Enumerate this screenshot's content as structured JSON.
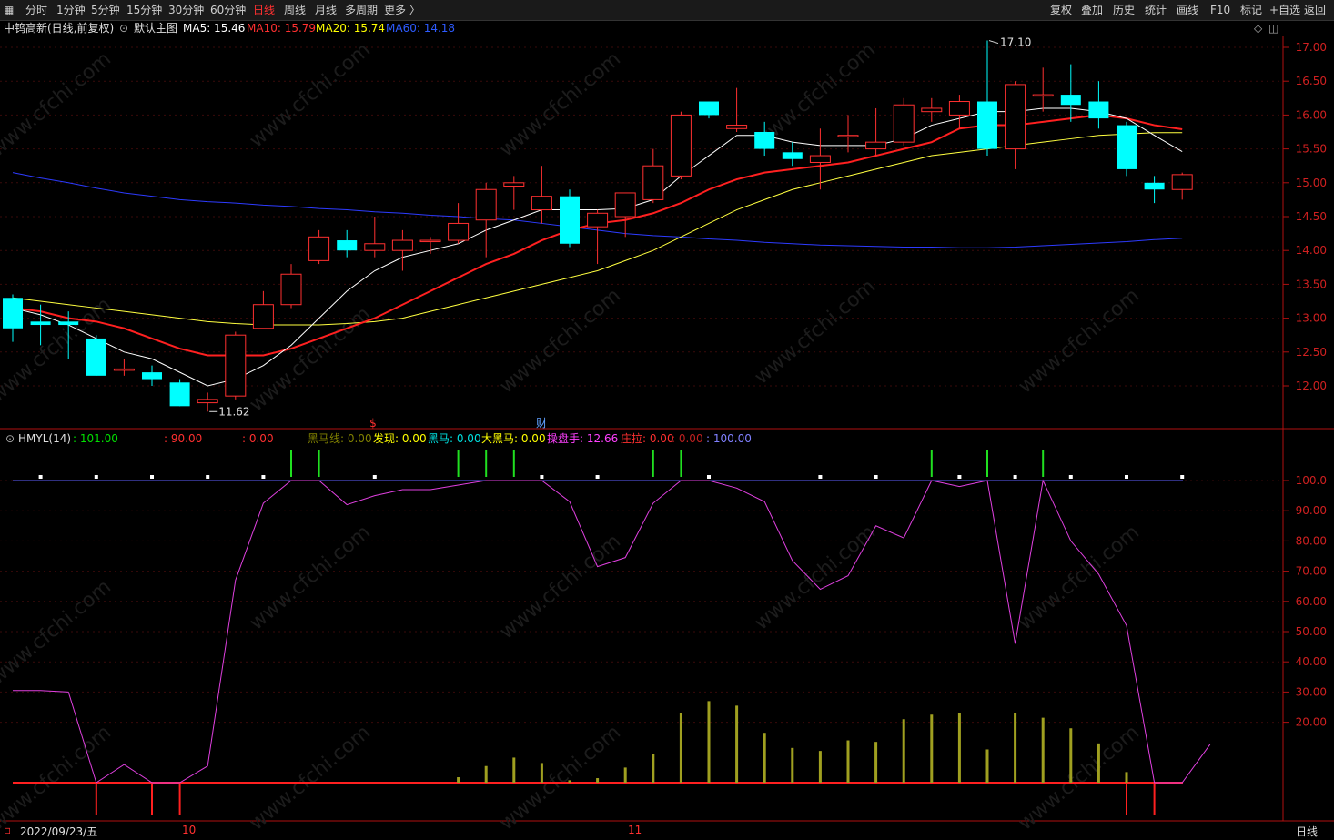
{
  "toolbar": {
    "left_icon": "grid-icon",
    "periods": [
      {
        "label": "分时",
        "active": false
      },
      {
        "label": "1分钟",
        "active": false
      },
      {
        "label": "5分钟",
        "active": false
      },
      {
        "label": "15分钟",
        "active": false
      },
      {
        "label": "30分钟",
        "active": false
      },
      {
        "label": "60分钟",
        "active": false
      },
      {
        "label": "日线",
        "active": true
      },
      {
        "label": "周线",
        "active": false
      },
      {
        "label": "月线",
        "active": false
      },
      {
        "label": "多周期",
        "active": false
      },
      {
        "label": "更多 〉",
        "active": false
      }
    ],
    "right_items": [
      "复权",
      "叠加",
      "历史",
      "统计",
      "画线",
      "F10",
      "标记",
      "+自选",
      "返回"
    ]
  },
  "main_chart": {
    "stock_title": "中钨高新(日线,前复权)",
    "template_label": "默认主图",
    "ma_labels": [
      {
        "text": "MA5: 15.46",
        "color": "#ffffff"
      },
      {
        "text": "MA10: 15.79",
        "color": "#ff3030"
      },
      {
        "text": "MA20: 15.74",
        "color": "#ffff00"
      },
      {
        "text": "MA60: 14.18",
        "color": "#2d5bff"
      }
    ],
    "high_label": "17.10",
    "low_label": "11.62",
    "marker_s": "$",
    "marker_cai": "财",
    "y_ticks": [
      "17.00",
      "16.50",
      "16.00",
      "15.50",
      "15.00",
      "14.50",
      "14.00",
      "13.50",
      "13.00",
      "12.50",
      "12.00"
    ],
    "watermark": "www.cfchi.com"
  },
  "indicator": {
    "name": "HMYL(14)",
    "values": [
      {
        "text": ": 101.00",
        "color": "#00e000"
      },
      {
        "text": ": 90.00",
        "color": "#ff3030"
      },
      {
        "text": ": 0.00",
        "color": "#ff3030"
      },
      {
        "text": "黑马线: 0.00",
        "color": "#808000"
      },
      {
        "text": "发现: 0.00",
        "color": "#ffff00"
      },
      {
        "text": "黑马: 0.00",
        "color": "#00e0e0"
      },
      {
        "text": "大黑马: 0.00",
        "color": "#ffff00"
      },
      {
        "text": "操盘手: 12.66",
        "color": "#ff40ff"
      },
      {
        "text": "庄拉: 0.00",
        "color": "#ff3030"
      },
      {
        "text": ": 0.00",
        "color": "#c02020"
      },
      {
        "text": ": 100.00",
        "color": "#8080ff"
      }
    ],
    "y_ticks": [
      "100.0",
      "90.00",
      "80.00",
      "70.00",
      "60.00",
      "50.00",
      "40.00",
      "30.00",
      "20.00"
    ]
  },
  "bottom": {
    "start_date": "2022/09/23/五",
    "month_10": "10",
    "month_11": "11",
    "period_label": "日线"
  },
  "chart_data": {
    "type": "candlestick",
    "candles": [
      {
        "o": 13.3,
        "h": 13.35,
        "l": 12.65,
        "c": 12.85
      },
      {
        "o": 12.95,
        "h": 13.2,
        "l": 12.6,
        "c": 12.9
      },
      {
        "o": 12.95,
        "h": 13.1,
        "l": 12.4,
        "c": 12.9
      },
      {
        "o": 12.7,
        "h": 12.75,
        "l": 12.15,
        "c": 12.15
      },
      {
        "o": 12.25,
        "h": 12.4,
        "l": 12.15,
        "c": 12.25
      },
      {
        "o": 12.2,
        "h": 12.3,
        "l": 12.0,
        "c": 12.1
      },
      {
        "o": 12.05,
        "h": 12.1,
        "l": 11.7,
        "c": 11.7
      },
      {
        "o": 11.75,
        "h": 11.9,
        "l": 11.62,
        "c": 11.8
      },
      {
        "o": 11.85,
        "h": 12.8,
        "l": 11.8,
        "c": 12.75
      },
      {
        "o": 12.85,
        "h": 13.4,
        "l": 12.85,
        "c": 13.2
      },
      {
        "o": 13.2,
        "h": 13.8,
        "l": 13.15,
        "c": 13.65
      },
      {
        "o": 13.85,
        "h": 14.3,
        "l": 13.8,
        "c": 14.2
      },
      {
        "o": 14.15,
        "h": 14.3,
        "l": 13.9,
        "c": 14.0
      },
      {
        "o": 14.0,
        "h": 14.5,
        "l": 13.9,
        "c": 14.1
      },
      {
        "o": 14.0,
        "h": 14.3,
        "l": 13.7,
        "c": 14.15
      },
      {
        "o": 14.15,
        "h": 14.2,
        "l": 13.95,
        "c": 14.15
      },
      {
        "o": 14.15,
        "h": 14.7,
        "l": 14.1,
        "c": 14.4
      },
      {
        "o": 14.45,
        "h": 15.0,
        "l": 13.9,
        "c": 14.9
      },
      {
        "o": 14.95,
        "h": 15.1,
        "l": 14.6,
        "c": 15.0
      },
      {
        "o": 14.6,
        "h": 15.25,
        "l": 14.4,
        "c": 14.8
      },
      {
        "o": 14.8,
        "h": 14.9,
        "l": 14.05,
        "c": 14.1
      },
      {
        "o": 14.35,
        "h": 14.6,
        "l": 13.8,
        "c": 14.55
      },
      {
        "o": 14.5,
        "h": 14.85,
        "l": 14.2,
        "c": 14.85
      },
      {
        "o": 14.75,
        "h": 15.5,
        "l": 14.7,
        "c": 15.25
      },
      {
        "o": 15.1,
        "h": 16.05,
        "l": 15.05,
        "c": 16.0
      },
      {
        "o": 16.2,
        "h": 16.2,
        "l": 15.95,
        "c": 16.0
      },
      {
        "o": 15.8,
        "h": 16.4,
        "l": 15.75,
        "c": 15.85
      },
      {
        "o": 15.75,
        "h": 15.9,
        "l": 15.4,
        "c": 15.5
      },
      {
        "o": 15.45,
        "h": 15.6,
        "l": 15.25,
        "c": 15.35
      },
      {
        "o": 15.3,
        "h": 15.8,
        "l": 14.9,
        "c": 15.4
      },
      {
        "o": 15.7,
        "h": 16.0,
        "l": 15.45,
        "c": 15.7
      },
      {
        "o": 15.5,
        "h": 16.1,
        "l": 15.4,
        "c": 15.6
      },
      {
        "o": 15.6,
        "h": 16.25,
        "l": 15.55,
        "c": 16.15
      },
      {
        "o": 16.05,
        "h": 16.25,
        "l": 15.9,
        "c": 16.1
      },
      {
        "o": 16.0,
        "h": 16.3,
        "l": 15.8,
        "c": 16.2
      },
      {
        "o": 16.2,
        "h": 17.1,
        "l": 15.4,
        "c": 15.5
      },
      {
        "o": 15.5,
        "h": 16.5,
        "l": 15.2,
        "c": 16.45
      },
      {
        "o": 16.3,
        "h": 16.7,
        "l": 16.05,
        "c": 16.3
      },
      {
        "o": 16.3,
        "h": 16.75,
        "l": 15.9,
        "c": 16.15
      },
      {
        "o": 16.2,
        "h": 16.5,
        "l": 15.8,
        "c": 15.95
      },
      {
        "o": 15.85,
        "h": 15.9,
        "l": 15.1,
        "c": 15.2
      },
      {
        "o": 15.0,
        "h": 15.1,
        "l": 14.7,
        "c": 14.9
      },
      {
        "o": 14.9,
        "h": 15.15,
        "l": 14.75,
        "c": 15.12
      }
    ],
    "ma5": [
      13.15,
      13.05,
      12.9,
      12.7,
      12.5,
      12.4,
      12.2,
      12.0,
      12.1,
      12.3,
      12.6,
      13.0,
      13.4,
      13.7,
      13.9,
      14.0,
      14.1,
      14.3,
      14.45,
      14.6,
      14.6,
      14.6,
      14.62,
      14.75,
      15.1,
      15.4,
      15.7,
      15.7,
      15.6,
      15.55,
      15.55,
      15.55,
      15.65,
      15.85,
      15.95,
      16.05,
      16.05,
      16.1,
      16.1,
      16.05,
      15.95,
      15.7,
      15.46
    ],
    "ma10": [
      13.15,
      13.1,
      13.0,
      12.95,
      12.85,
      12.7,
      12.55,
      12.45,
      12.45,
      12.45,
      12.55,
      12.7,
      12.85,
      13.0,
      13.2,
      13.4,
      13.6,
      13.8,
      13.95,
      14.15,
      14.3,
      14.4,
      14.45,
      14.55,
      14.7,
      14.9,
      15.05,
      15.15,
      15.2,
      15.25,
      15.3,
      15.4,
      15.5,
      15.6,
      15.8,
      15.85,
      15.85,
      15.9,
      15.95,
      16.0,
      15.95,
      15.85,
      15.79
    ],
    "ma20": [
      13.3,
      13.25,
      13.2,
      13.15,
      13.1,
      13.05,
      13.0,
      12.95,
      12.92,
      12.9,
      12.9,
      12.9,
      12.92,
      12.95,
      13.0,
      13.1,
      13.2,
      13.3,
      13.4,
      13.5,
      13.6,
      13.7,
      13.85,
      14.0,
      14.2,
      14.4,
      14.6,
      14.75,
      14.9,
      15.0,
      15.1,
      15.2,
      15.3,
      15.4,
      15.45,
      15.5,
      15.55,
      15.6,
      15.65,
      15.7,
      15.72,
      15.74,
      15.74
    ],
    "ma60": [
      15.15,
      15.07,
      15.0,
      14.92,
      14.85,
      14.8,
      14.75,
      14.72,
      14.7,
      14.67,
      14.65,
      14.62,
      14.6,
      14.57,
      14.55,
      14.52,
      14.5,
      14.47,
      14.45,
      14.4,
      14.35,
      14.3,
      14.25,
      14.22,
      14.2,
      14.17,
      14.15,
      14.12,
      14.1,
      14.08,
      14.07,
      14.06,
      14.05,
      14.05,
      14.04,
      14.04,
      14.05,
      14.07,
      14.09,
      14.11,
      14.13,
      14.16,
      14.18
    ],
    "ind_line": [
      30.5,
      30.5,
      30.0,
      0.0,
      6.0,
      0.0,
      0.0,
      5.5,
      67.0,
      92.5,
      100.0,
      100.0,
      92.0,
      95.0,
      97.0,
      97.0,
      98.5,
      100.0,
      100.0,
      100.0,
      93.0,
      71.5,
      74.5,
      92.5,
      100.0,
      100.0,
      97.5,
      93.0,
      73.5,
      64.0,
      68.5,
      85.0,
      81.0,
      100.0,
      98.0,
      100.0,
      46.0,
      100.0,
      80.0,
      69.0,
      52.0,
      0.0,
      0.0,
      12.66
    ],
    "ind_bars": [
      0,
      0,
      0,
      0,
      0,
      0,
      0,
      0,
      0,
      0,
      0,
      0,
      0,
      0,
      0,
      0,
      1.8,
      5.5,
      8.3,
      6.5,
      0.8,
      1.5,
      5.0,
      9.5,
      23.0,
      27.0,
      25.5,
      16.5,
      11.5,
      10.5,
      14.0,
      13.5,
      21.0,
      22.5,
      23.0,
      11.0,
      23.0,
      21.5,
      18.0,
      13.0,
      3.5,
      0,
      0
    ],
    "ind_neg": [
      0,
      0,
      0,
      1,
      0,
      1,
      1,
      0,
      0,
      0,
      0,
      0,
      0,
      0,
      0,
      0,
      0,
      0,
      0,
      0,
      0,
      0,
      0,
      0,
      0,
      0,
      0,
      0,
      0,
      0,
      0,
      0,
      0,
      0,
      0,
      0,
      0,
      0,
      0,
      0,
      1,
      1,
      0
    ],
    "ind_green_top": [
      0,
      0,
      0,
      0,
      0,
      0,
      0,
      0,
      0,
      0,
      1,
      1,
      0,
      0,
      0,
      0,
      1,
      1,
      1,
      0,
      0,
      0,
      0,
      1,
      1,
      0,
      0,
      0,
      0,
      0,
      0,
      0,
      0,
      1,
      0,
      1,
      0,
      1,
      0,
      0,
      0,
      0,
      0
    ],
    "y_range_price": [
      11.55,
      17.25
    ],
    "y_range_ind": [
      -10,
      110
    ]
  }
}
